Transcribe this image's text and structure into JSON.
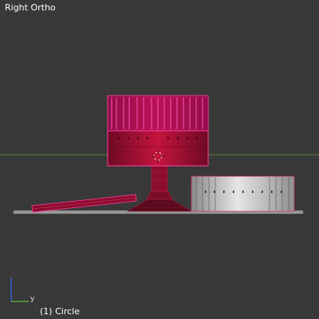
{
  "viewport": {
    "view_name": "Right Ortho",
    "object_info": "(1) Circle",
    "grid_color": "#343434",
    "background_color": "#393939",
    "horizon_color": "#5a8a3a"
  },
  "gizmo": {
    "horizontal_axis": "y",
    "horizontal_color": "#5aa838",
    "vertical_color": "#3a5fd0"
  },
  "objects": {
    "selected_color": "#a0103a",
    "selected_edge_color": "#ff40a0",
    "unselected_color": "#cfcfcf"
  }
}
